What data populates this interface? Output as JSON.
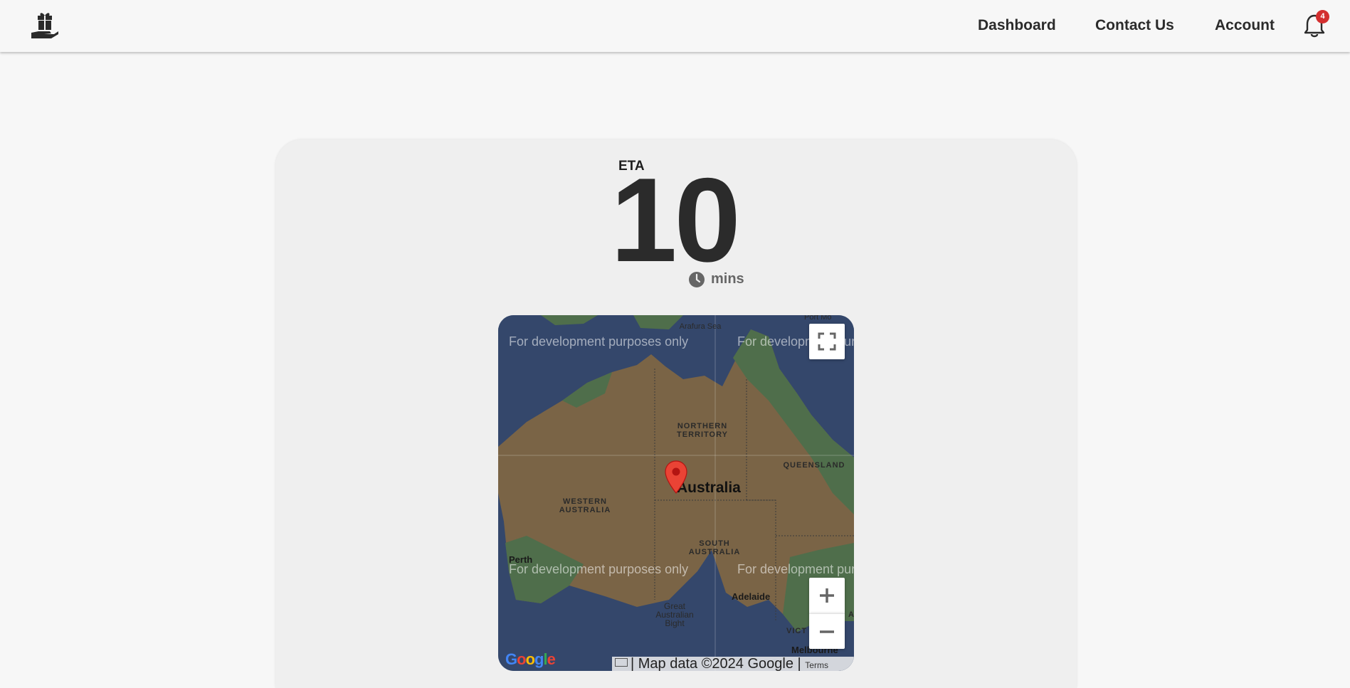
{
  "nav": {
    "logo_icon": "gift-hand-icon",
    "links": [
      "Dashboard",
      "Contact Us",
      "Account"
    ],
    "notification_count": "4",
    "bell_icon": "bell-icon"
  },
  "eta": {
    "label": "ETA",
    "value": "10",
    "unit": "mins",
    "unit_icon": "clock-icon"
  },
  "map": {
    "watermark": "For development purposes only",
    "country_label": "Australia",
    "regions": [
      "NORTHERN\nTERRITORY",
      "QUEENSLAND",
      "WESTERN\nAUSTRALIA",
      "SOUTH\nAUSTRALIA"
    ],
    "cities": [
      "Perth",
      "Adelaide",
      "Melbourne"
    ],
    "water_label": "Great\nAustralian\nBight",
    "top_labels": [
      "Arafura Sea",
      "Port Mo"
    ],
    "misc_labels": [
      "VICT",
      "A"
    ],
    "logo_text": "Google",
    "attribution": "| Map data ©2024 Google |",
    "terms": "Terms",
    "colors": {
      "water": "#34476b",
      "land": "#7a6446",
      "vegetation": "#4f6e4b",
      "pin": "#ea4335"
    }
  }
}
